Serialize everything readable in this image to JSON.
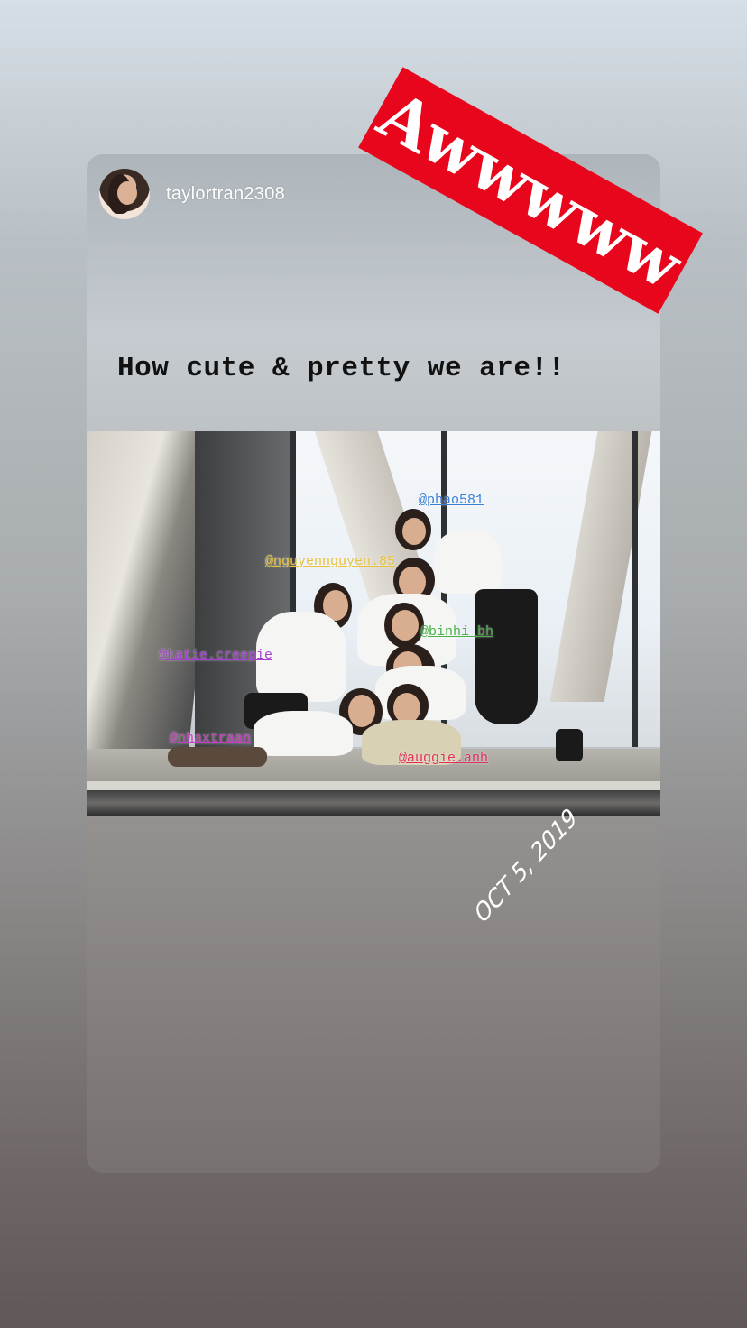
{
  "story": {
    "username": "taylortran2308",
    "caption": "How cute & pretty we are!!",
    "sticker_text": "Awwwww",
    "date_label": "OCT 5, 2019",
    "mentions": [
      {
        "handle": "@phao581",
        "color": "#3b7fd6"
      },
      {
        "handle": "@nguyennguyen.85",
        "color": "#e8c23a"
      },
      {
        "handle": "@binhi_bh",
        "color": "#4ab04a"
      },
      {
        "handle": "@katie.creepie",
        "color": "#a53fd1"
      },
      {
        "handle": "@nhaxtraan",
        "color": "#c23fbf"
      },
      {
        "handle": "@auggie.anh",
        "color": "#e0305a"
      }
    ]
  },
  "colors": {
    "sticker_bg": "#e8061c",
    "caption_text": "#111111",
    "username_text": "#ffffff"
  }
}
